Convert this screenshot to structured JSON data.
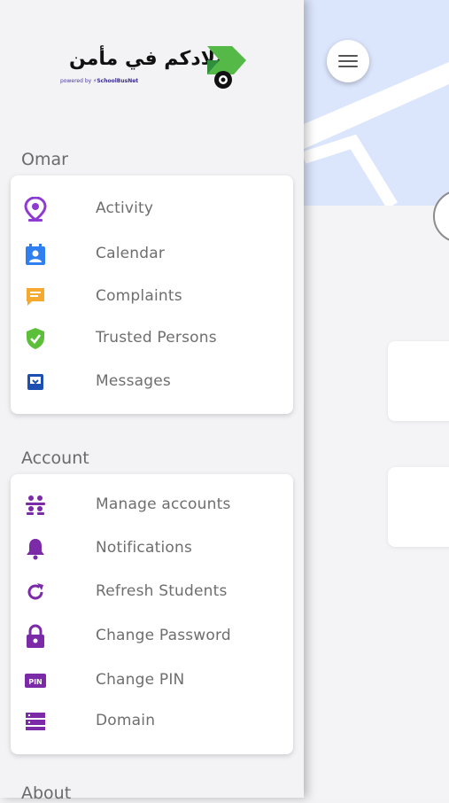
{
  "drawer": {
    "logo": {
      "arabic_text": "اولادكم في مأمن",
      "powered_by": "powered by",
      "brand": "SchoolBusNet"
    },
    "sections": [
      {
        "title": "Omar",
        "items": [
          {
            "label": "Activity",
            "icon": "location-pin-icon",
            "color": "#8e3bd3"
          },
          {
            "label": "Calendar",
            "icon": "calendar-person-icon",
            "color": "#2f7ff0"
          },
          {
            "label": "Complaints",
            "icon": "message-icon",
            "color": "#f6a92f"
          },
          {
            "label": "Trusted Persons",
            "icon": "shield-check-icon",
            "color": "#5bbf3a"
          },
          {
            "label": "Messages",
            "icon": "inbox-icon",
            "color": "#1d4fb3"
          }
        ]
      },
      {
        "title": "Account",
        "items": [
          {
            "label": "Manage accounts",
            "icon": "manage-accounts-icon",
            "color": "#7b2aa8"
          },
          {
            "label": "Notifications",
            "icon": "bell-icon",
            "color": "#7b2aa8"
          },
          {
            "label": "Refresh Students",
            "icon": "refresh-icon",
            "color": "#7b2aa8"
          },
          {
            "label": "Change Password",
            "icon": "lock-icon",
            "color": "#7b2aa8"
          },
          {
            "label": "Change PIN",
            "icon": "pin-icon",
            "color": "#7b2aa8"
          },
          {
            "label": "Domain",
            "icon": "server-icon",
            "color": "#7b2aa8"
          }
        ]
      },
      {
        "title": "About",
        "items": []
      }
    ]
  }
}
